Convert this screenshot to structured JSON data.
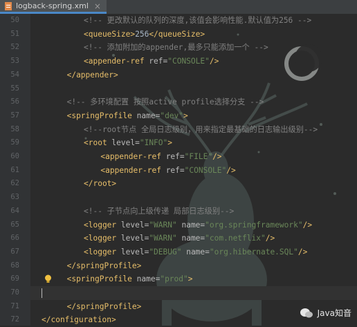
{
  "tab": {
    "filename": "logback-spring.xml",
    "close": "×"
  },
  "lines": [
    {
      "n": "50",
      "indent": 5,
      "parts": [
        [
          "cmt",
          "<!-- 更改默认的队列的深度,该值会影响性能.默认值为256 -->"
        ]
      ]
    },
    {
      "n": "51",
      "indent": 5,
      "parts": [
        [
          "tag",
          "<queueSize>"
        ],
        [
          "txt",
          "256"
        ],
        [
          "tag",
          "</queueSize>"
        ]
      ]
    },
    {
      "n": "52",
      "indent": 5,
      "parts": [
        [
          "cmt",
          "<!-- 添加附加的appender,最多只能添加一个 -->"
        ]
      ]
    },
    {
      "n": "53",
      "indent": 5,
      "parts": [
        [
          "tag",
          "<appender-ref "
        ],
        [
          "attr",
          "ref="
        ],
        [
          "val",
          "\"CONSOLE\""
        ],
        [
          "tag",
          "/>"
        ]
      ]
    },
    {
      "n": "54",
      "indent": 3,
      "parts": [
        [
          "tag",
          "</appender>"
        ]
      ]
    },
    {
      "n": "55",
      "indent": 0,
      "parts": []
    },
    {
      "n": "56",
      "indent": 3,
      "parts": [
        [
          "cmt",
          "<!-- 多环境配置 按照active profile选择分支 -->"
        ]
      ]
    },
    {
      "n": "57",
      "indent": 3,
      "parts": [
        [
          "tag",
          "<springProfile "
        ],
        [
          "attr",
          "name="
        ],
        [
          "val",
          "\"dev\""
        ],
        [
          "tag",
          ">"
        ]
      ]
    },
    {
      "n": "58",
      "indent": 5,
      "parts": [
        [
          "cmt",
          "<!--root节点 全局日志级别，用来指定最基础的日志输出级别-->"
        ]
      ]
    },
    {
      "n": "59",
      "indent": 5,
      "parts": [
        [
          "tag",
          "<root "
        ],
        [
          "attr",
          "level="
        ],
        [
          "val",
          "\"INFO\""
        ],
        [
          "tag",
          ">"
        ]
      ]
    },
    {
      "n": "60",
      "indent": 7,
      "parts": [
        [
          "tag",
          "<appender-ref "
        ],
        [
          "attr",
          "ref="
        ],
        [
          "val",
          "\"FILE\""
        ],
        [
          "tag",
          "/>"
        ]
      ]
    },
    {
      "n": "61",
      "indent": 7,
      "parts": [
        [
          "tag",
          "<appender-ref "
        ],
        [
          "attr",
          "ref="
        ],
        [
          "val",
          "\"CONSOLE\""
        ],
        [
          "tag",
          "/>"
        ]
      ]
    },
    {
      "n": "62",
      "indent": 5,
      "parts": [
        [
          "tag",
          "</root>"
        ]
      ]
    },
    {
      "n": "63",
      "indent": 0,
      "parts": []
    },
    {
      "n": "64",
      "indent": 5,
      "parts": [
        [
          "cmt",
          "<!-- 子节点向上级传递 局部日志级别-->"
        ]
      ]
    },
    {
      "n": "65",
      "indent": 5,
      "parts": [
        [
          "tag",
          "<logger "
        ],
        [
          "attr",
          "level="
        ],
        [
          "val",
          "\"WARN\" "
        ],
        [
          "attr",
          "name="
        ],
        [
          "val",
          "\"org.springframework\""
        ],
        [
          "tag",
          "/>"
        ]
      ]
    },
    {
      "n": "66",
      "indent": 5,
      "parts": [
        [
          "tag",
          "<logger "
        ],
        [
          "attr",
          "level="
        ],
        [
          "val",
          "\"WARN\" "
        ],
        [
          "attr",
          "name="
        ],
        [
          "val",
          "\"com.netflix\""
        ],
        [
          "tag",
          "/>"
        ]
      ]
    },
    {
      "n": "67",
      "indent": 5,
      "parts": [
        [
          "tag",
          "<logger "
        ],
        [
          "attr",
          "level="
        ],
        [
          "val",
          "\"DEBUG\" "
        ],
        [
          "attr",
          "name="
        ],
        [
          "val",
          "\"org.hibernate.SQL\""
        ],
        [
          "tag",
          "/>"
        ]
      ]
    },
    {
      "n": "68",
      "indent": 3,
      "parts": [
        [
          "tag",
          "</springProfile>"
        ]
      ]
    },
    {
      "n": "69",
      "indent": 3,
      "parts": [
        [
          "tag",
          "<springProfile "
        ],
        [
          "attr",
          "name="
        ],
        [
          "val",
          "\"prod\""
        ],
        [
          "tag",
          ">"
        ]
      ],
      "bulb": true
    },
    {
      "n": "70",
      "indent": 0,
      "parts": [],
      "current": true
    },
    {
      "n": "71",
      "indent": 3,
      "parts": [
        [
          "tag",
          "</springProfile>"
        ]
      ]
    },
    {
      "n": "72",
      "indent": 0,
      "parts": [
        [
          "tag",
          "</configuration>"
        ]
      ]
    }
  ],
  "watermark": {
    "text": "Java知音"
  }
}
